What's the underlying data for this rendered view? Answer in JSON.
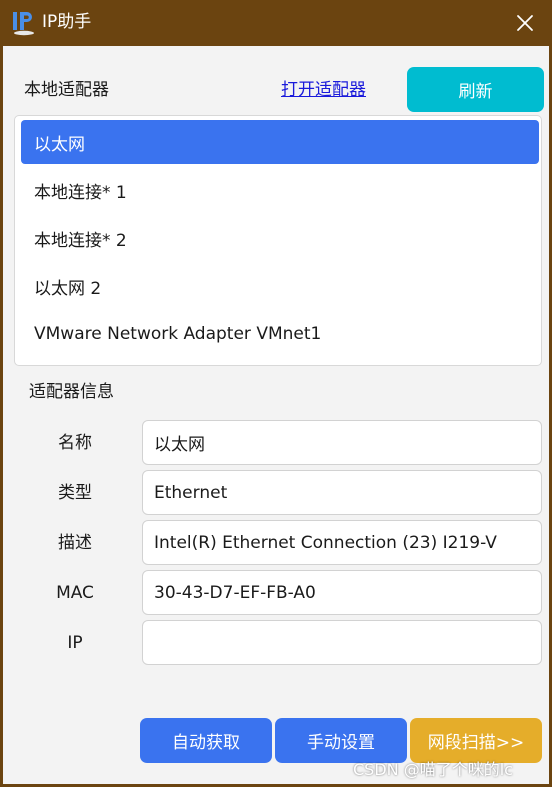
{
  "window": {
    "title": "IP助手",
    "icon": "ip-logo-icon",
    "close_icon": "close-icon",
    "accent_color": "#6b4410"
  },
  "adapters": {
    "section_label": "本地适配器",
    "open_link": "打开适配器",
    "refresh_label": "刷新",
    "items": [
      {
        "label": "以太网",
        "selected": true
      },
      {
        "label": "本地连接* 1",
        "selected": false
      },
      {
        "label": "本地连接* 2",
        "selected": false
      },
      {
        "label": "以太网 2",
        "selected": false
      },
      {
        "label": "VMware Network Adapter VMnet1",
        "selected": false
      }
    ],
    "selected_color": "#3a73ef"
  },
  "info": {
    "section_label": "适配器信息",
    "fields": [
      {
        "label": "名称",
        "value": "以太网"
      },
      {
        "label": "类型",
        "value": "Ethernet"
      },
      {
        "label": "描述",
        "value": "Intel(R) Ethernet Connection (23) I219-V"
      },
      {
        "label": "MAC",
        "value": "30-43-D7-EF-FB-A0"
      },
      {
        "label": "IP",
        "value": ""
      }
    ]
  },
  "actions": {
    "auto_label": "自动获取",
    "manual_label": "手动设置",
    "scan_label": "网段扫描>>",
    "primary_color": "#3a73ef",
    "refresh_color": "#00bcd0",
    "scan_color": "#e5ad2a"
  },
  "watermark": "CSDN @喵了个咪的lc"
}
